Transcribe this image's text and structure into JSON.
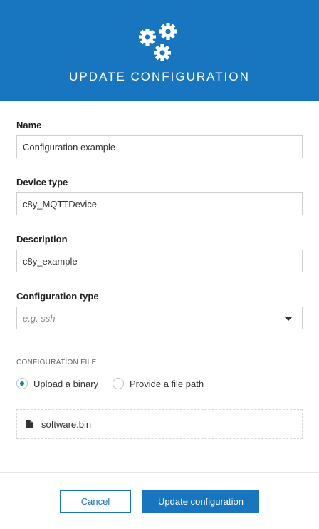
{
  "header": {
    "icon": "gears-icon",
    "title": "UPDATE CONFIGURATION"
  },
  "form": {
    "name": {
      "label": "Name",
      "value": "Configuration example"
    },
    "device_type": {
      "label": "Device type",
      "value": "c8y_MQTTDevice"
    },
    "description": {
      "label": "Description",
      "value": "c8y_example"
    },
    "configuration_type": {
      "label": "Configuration type",
      "placeholder": "e.g. ssh",
      "selected": ""
    }
  },
  "configuration_file": {
    "section_title": "CONFIGURATION FILE",
    "options": [
      {
        "label": "Upload a binary",
        "checked": true
      },
      {
        "label": "Provide a file path",
        "checked": false
      }
    ],
    "file": {
      "icon": "file-icon",
      "name": "software.bin"
    }
  },
  "footer": {
    "cancel_label": "Cancel",
    "submit_label": "Update configuration"
  },
  "colors": {
    "accent": "#1776bf",
    "border": "#cfcfcf"
  }
}
